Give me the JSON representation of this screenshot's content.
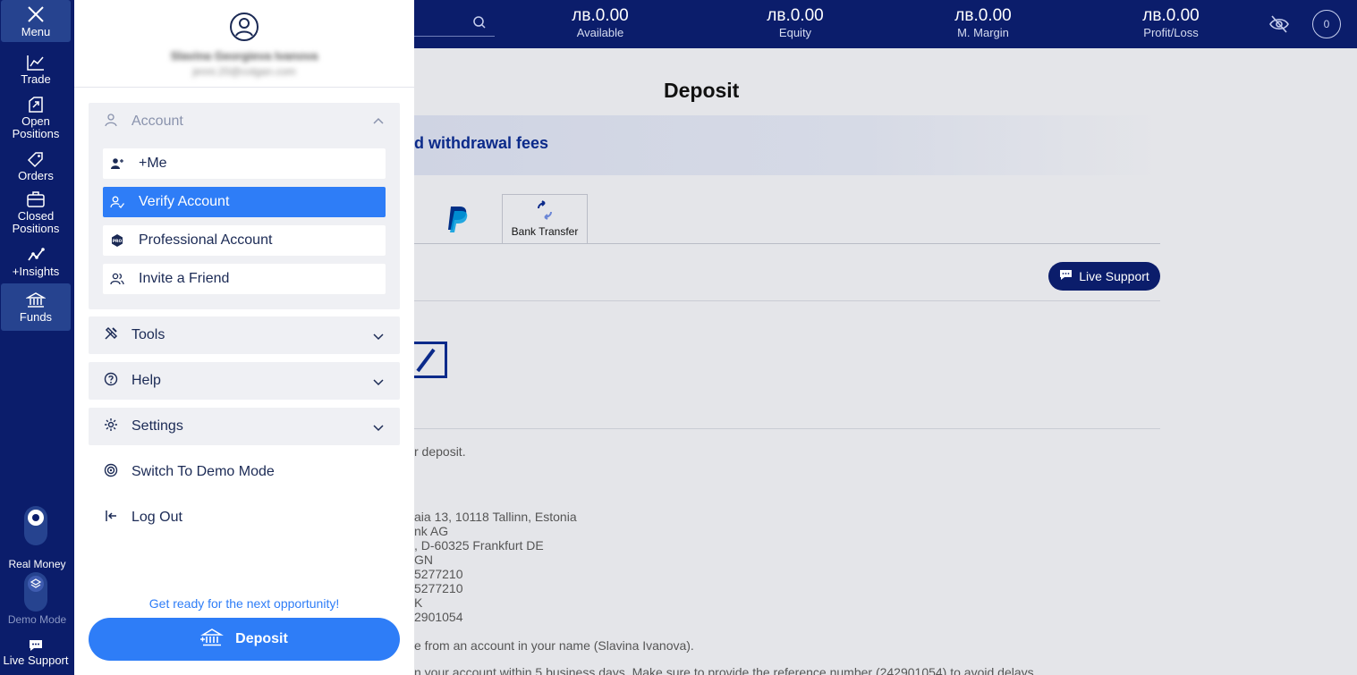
{
  "rail": {
    "menu_label": "Menu",
    "trade_label": "Trade",
    "open_positions_label": "Open Positions",
    "orders_label": "Orders",
    "closed_positions_label": "Closed Positions",
    "insights_label": "+Insights",
    "funds_label": "Funds",
    "real_money_label": "Real Money",
    "demo_mode_label": "Demo Mode",
    "live_support_label": "Live Support"
  },
  "topbar": {
    "metrics": [
      {
        "value": "лв.0.00",
        "label": "Available"
      },
      {
        "value": "лв.0.00",
        "label": "Equity"
      },
      {
        "value": "лв.0.00",
        "label": "M. Margin"
      },
      {
        "value": "лв.0.00",
        "label": "Profit/Loss"
      }
    ],
    "notification_count": "0"
  },
  "profile": {
    "name": "Slavina Georgieva Ivanova",
    "email": "jenni.20@colgan.com"
  },
  "menu": {
    "account": {
      "label": "Account",
      "items": [
        {
          "label": "+Me"
        },
        {
          "label": "Verify Account"
        },
        {
          "label": "Professional Account"
        },
        {
          "label": "Invite a Friend"
        }
      ]
    },
    "tools_label": "Tools",
    "help_label": "Help",
    "settings_label": "Settings",
    "demo_label": "Switch To Demo Mode",
    "logout_label": "Log Out",
    "promo_text": "Get ready for the next opportunity!",
    "deposit_label": "Deposit"
  },
  "main": {
    "title": "Deposit",
    "banner_text": "d withdrawal fees",
    "bank_transfer_tab": "Bank Transfer",
    "live_support_button": "Live Support",
    "lines": [
      "r deposit.",
      "aia 13, 10118 Tallinn, Estonia",
      "nk AG",
      ", D-60325 Frankfurt DE",
      "GN",
      "5277210",
      "5277210",
      "K",
      "2901054",
      "e from an account in your name (Slavina Ivanova).",
      "n your account within 5 business days. Make sure to provide the reference number (242901054) to avoid delays."
    ]
  },
  "colors": {
    "navy": "#0b1d6b",
    "accent_blue": "#2e7df7",
    "rail_active": "#26438f"
  }
}
